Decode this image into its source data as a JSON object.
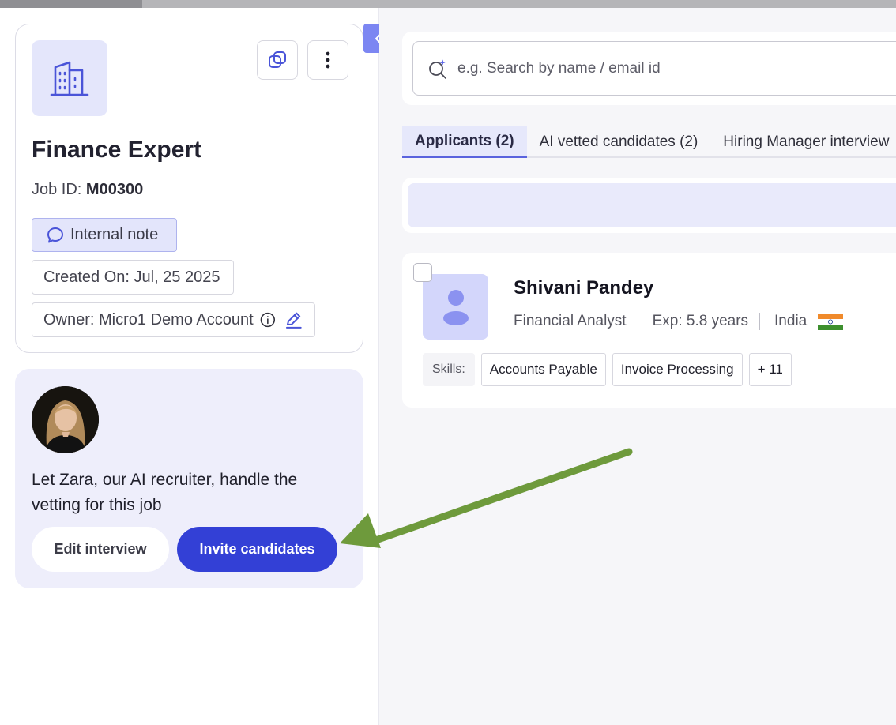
{
  "job": {
    "title": "Finance Expert",
    "job_id_label": "Job ID: ",
    "job_id": "M00300",
    "internal_note_label": "Internal note",
    "created_on": "Created On: Jul, 25 2025",
    "owner": "Owner: Micro1 Demo Account"
  },
  "zara": {
    "message": "Let Zara, our AI recruiter, handle the vetting for this job",
    "edit_label": "Edit interview",
    "invite_label": "Invite candidates"
  },
  "search": {
    "placeholder": "e.g. Search by name / email id"
  },
  "tabs": [
    {
      "label": "Applicants (2)",
      "active": true
    },
    {
      "label": "AI vetted candidates (2)",
      "active": false
    },
    {
      "label": "Hiring Manager interview",
      "active": false
    }
  ],
  "candidate": {
    "name": "Shivani Pandey",
    "role": "Financial Analyst",
    "experience": "Exp: 5.8 years",
    "country": "India",
    "skills_label": "Skills:",
    "skills": [
      "Accounts Payable",
      "Invoice Processing"
    ],
    "more_skills": "+ 11"
  },
  "colors": {
    "primary": "#3340d6",
    "accent_light": "#e4e6fb",
    "annotation_arrow": "#6e9a3c"
  }
}
